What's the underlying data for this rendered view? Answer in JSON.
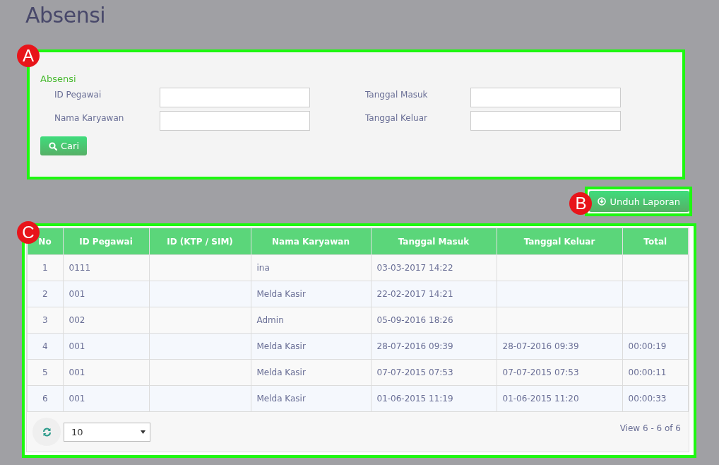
{
  "page_title": "Absensi",
  "search_form": {
    "marker": "A",
    "title": "Absensi",
    "fields": [
      {
        "label": "ID Pegawai"
      },
      {
        "label": "Tanggal Masuk"
      },
      {
        "label": "Nama Karyawan"
      },
      {
        "label": "Tanggal Keluar"
      }
    ],
    "search_button": "Cari"
  },
  "download_button": {
    "marker": "B",
    "label": "Unduh Laporan"
  },
  "table": {
    "marker": "C",
    "columns": [
      "No",
      "ID Pegawai",
      "ID (KTP / SIM)",
      "Nama Karyawan",
      "Tanggal Masuk",
      "Tanggal Keluar",
      "Total"
    ],
    "rows": [
      [
        "1",
        "0111",
        null,
        "ina",
        "03-03-2017 14:22",
        null,
        null
      ],
      [
        "2",
        "001",
        null,
        "Melda Kasir",
        "22-02-2017 14:21",
        null,
        null
      ],
      [
        "3",
        "002",
        null,
        "Admin",
        "05-09-2016 18:26",
        null,
        null
      ],
      [
        "4",
        "001",
        null,
        "Melda Kasir",
        "28-07-2016 09:39",
        "28-07-2016 09:39",
        "00:00:19"
      ],
      [
        "5",
        "001",
        null,
        "Melda Kasir",
        "07-07-2015 07:53",
        "07-07-2015 07:53",
        "00:00:11"
      ],
      [
        "6",
        "001",
        null,
        "Melda Kasir",
        "01-06-2015 11:19",
        "01-06-2015 11:20",
        "00:00:33"
      ]
    ],
    "page_size": "10",
    "record_info": "View 6 - 6 of 6"
  }
}
